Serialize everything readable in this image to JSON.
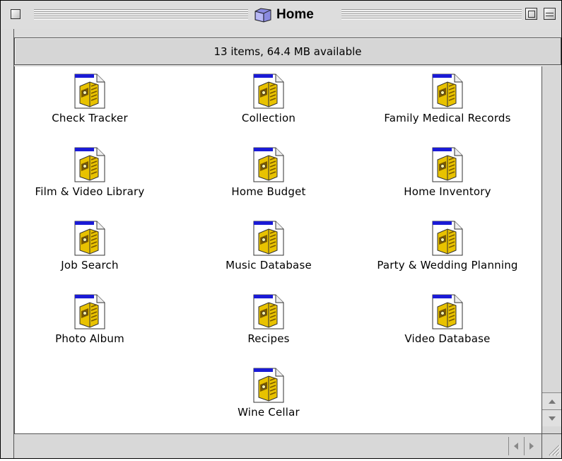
{
  "window": {
    "title": "Home",
    "title_icon": "folder-icon",
    "status": "13 items, 64.4 MB available"
  },
  "items": [
    {
      "label": "Check Tracker",
      "icon": "database-document-icon"
    },
    {
      "label": "Collection",
      "icon": "database-document-icon"
    },
    {
      "label": "Family Medical Records",
      "icon": "database-document-icon"
    },
    {
      "label": "Film & Video Library",
      "icon": "database-document-icon"
    },
    {
      "label": "Home Budget",
      "icon": "database-document-icon"
    },
    {
      "label": "Home Inventory",
      "icon": "database-document-icon"
    },
    {
      "label": "Job Search",
      "icon": "database-document-icon"
    },
    {
      "label": "Music Database",
      "icon": "database-document-icon"
    },
    {
      "label": "Party & Wedding Planning",
      "icon": "database-document-icon"
    },
    {
      "label": "Photo Album",
      "icon": "database-document-icon"
    },
    {
      "label": "Recipes",
      "icon": "database-document-icon"
    },
    {
      "label": "Video Database",
      "icon": "database-document-icon"
    },
    {
      "label": "Wine Cellar",
      "icon": "database-document-icon"
    }
  ],
  "colors": {
    "document_tab": "#1a1ad6",
    "book_body": "#e8c200",
    "book_dark": "#7a5a00"
  }
}
